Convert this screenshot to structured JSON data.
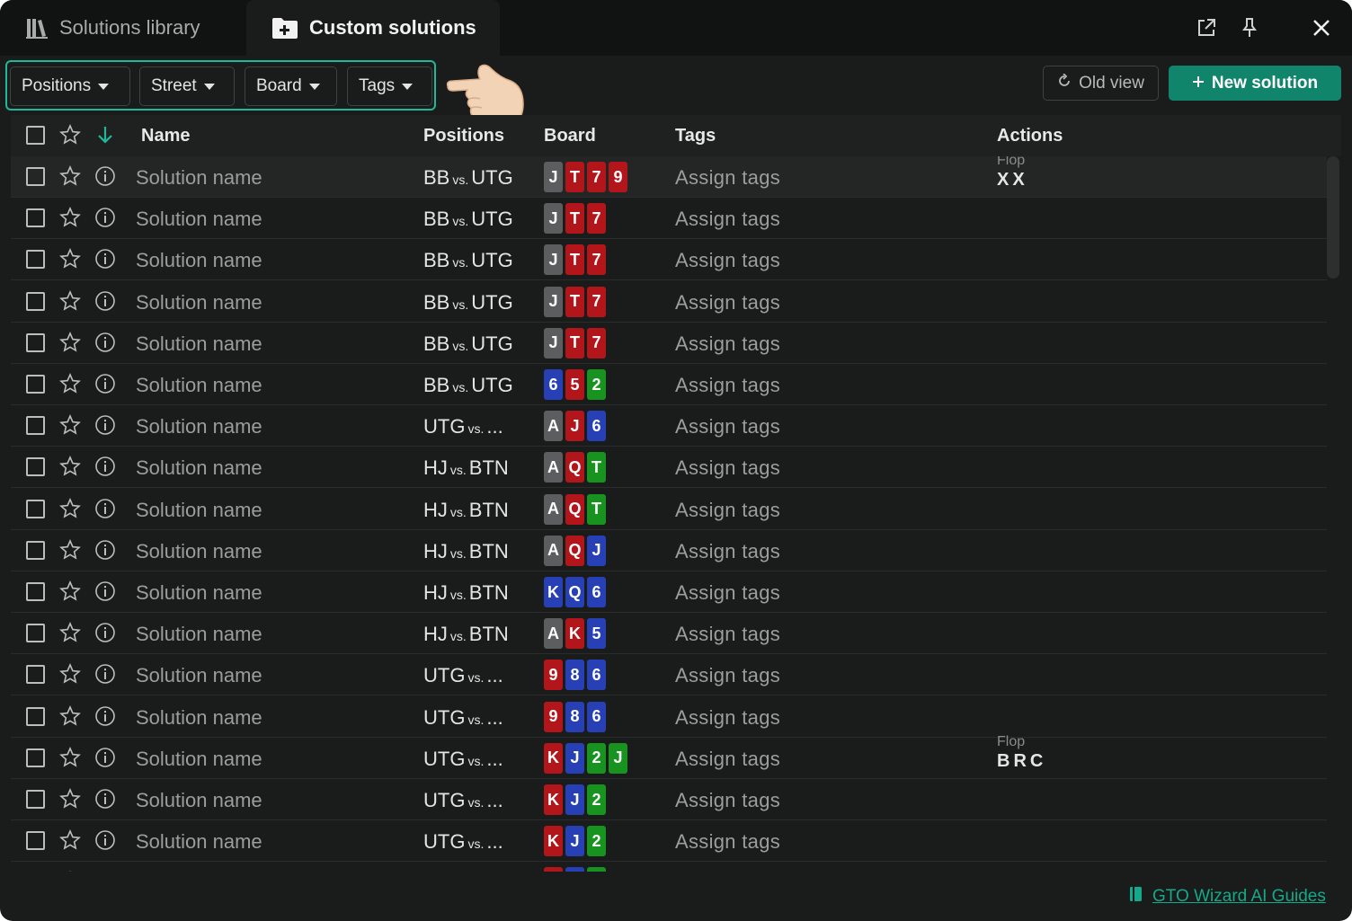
{
  "tabs": {
    "library_label": "Solutions library",
    "custom_label": "Custom solutions"
  },
  "filters": [
    {
      "label": "Positions"
    },
    {
      "label": "Street"
    },
    {
      "label": "Board"
    },
    {
      "label": "Tags"
    }
  ],
  "toolbar": {
    "old_view_label": "Old view",
    "new_solution_label": "New solution"
  },
  "columns": {
    "name": "Name",
    "positions": "Positions",
    "board": "Board",
    "tags": "Tags",
    "actions": "Actions"
  },
  "colors": {
    "accent": "#11856b",
    "filter_outline": "#1fb89a",
    "suit_spades": "#5b5d5e",
    "suit_hearts": "#b3161a",
    "suit_diamonds": "#2740b6",
    "suit_clubs": "#18931f"
  },
  "rows": [
    {
      "name": "Solution name",
      "pos_a": "BB",
      "vs": "vs.",
      "pos_b": "UTG",
      "cards": [
        {
          "r": "J",
          "s": "gray"
        },
        {
          "r": "T",
          "s": "red"
        },
        {
          "r": "7",
          "s": "red"
        },
        {
          "r": "9",
          "s": "red"
        }
      ],
      "tags": "Assign tags",
      "action_label": "Flop",
      "action_value": "XX",
      "selected": true
    },
    {
      "name": "Solution name",
      "pos_a": "BB",
      "vs": "vs.",
      "pos_b": "UTG",
      "cards": [
        {
          "r": "J",
          "s": "gray"
        },
        {
          "r": "T",
          "s": "red"
        },
        {
          "r": "7",
          "s": "red"
        }
      ],
      "tags": "Assign tags"
    },
    {
      "name": "Solution name",
      "pos_a": "BB",
      "vs": "vs.",
      "pos_b": "UTG",
      "cards": [
        {
          "r": "J",
          "s": "gray"
        },
        {
          "r": "T",
          "s": "red"
        },
        {
          "r": "7",
          "s": "red"
        }
      ],
      "tags": "Assign tags"
    },
    {
      "name": "Solution name",
      "pos_a": "BB",
      "vs": "vs.",
      "pos_b": "UTG",
      "cards": [
        {
          "r": "J",
          "s": "gray"
        },
        {
          "r": "T",
          "s": "red"
        },
        {
          "r": "7",
          "s": "red"
        }
      ],
      "tags": "Assign tags"
    },
    {
      "name": "Solution name",
      "pos_a": "BB",
      "vs": "vs.",
      "pos_b": "UTG",
      "cards": [
        {
          "r": "J",
          "s": "gray"
        },
        {
          "r": "T",
          "s": "red"
        },
        {
          "r": "7",
          "s": "red"
        }
      ],
      "tags": "Assign tags"
    },
    {
      "name": "Solution name",
      "pos_a": "BB",
      "vs": "vs.",
      "pos_b": "UTG",
      "cards": [
        {
          "r": "6",
          "s": "blue"
        },
        {
          "r": "5",
          "s": "red"
        },
        {
          "r": "2",
          "s": "green"
        }
      ],
      "tags": "Assign tags"
    },
    {
      "name": "Solution name",
      "pos_a": "UTG",
      "vs": "vs.",
      "pos_b": "...",
      "cards": [
        {
          "r": "A",
          "s": "gray"
        },
        {
          "r": "J",
          "s": "red"
        },
        {
          "r": "6",
          "s": "blue"
        }
      ],
      "tags": "Assign tags"
    },
    {
      "name": "Solution name",
      "pos_a": "HJ",
      "vs": "vs.",
      "pos_b": "BTN",
      "cards": [
        {
          "r": "A",
          "s": "gray"
        },
        {
          "r": "Q",
          "s": "red"
        },
        {
          "r": "T",
          "s": "green"
        }
      ],
      "tags": "Assign tags"
    },
    {
      "name": "Solution name",
      "pos_a": "HJ",
      "vs": "vs.",
      "pos_b": "BTN",
      "cards": [
        {
          "r": "A",
          "s": "gray"
        },
        {
          "r": "Q",
          "s": "red"
        },
        {
          "r": "T",
          "s": "green"
        }
      ],
      "tags": "Assign tags"
    },
    {
      "name": "Solution name",
      "pos_a": "HJ",
      "vs": "vs.",
      "pos_b": "BTN",
      "cards": [
        {
          "r": "A",
          "s": "gray"
        },
        {
          "r": "Q",
          "s": "red"
        },
        {
          "r": "J",
          "s": "blue"
        }
      ],
      "tags": "Assign tags"
    },
    {
      "name": "Solution name",
      "pos_a": "HJ",
      "vs": "vs.",
      "pos_b": "BTN",
      "cards": [
        {
          "r": "K",
          "s": "blue"
        },
        {
          "r": "Q",
          "s": "blue"
        },
        {
          "r": "6",
          "s": "blue"
        }
      ],
      "tags": "Assign tags"
    },
    {
      "name": "Solution name",
      "pos_a": "HJ",
      "vs": "vs.",
      "pos_b": "BTN",
      "cards": [
        {
          "r": "A",
          "s": "gray"
        },
        {
          "r": "K",
          "s": "red"
        },
        {
          "r": "5",
          "s": "blue"
        }
      ],
      "tags": "Assign tags"
    },
    {
      "name": "Solution name",
      "pos_a": "UTG",
      "vs": "vs.",
      "pos_b": "...",
      "cards": [
        {
          "r": "9",
          "s": "red"
        },
        {
          "r": "8",
          "s": "blue"
        },
        {
          "r": "6",
          "s": "blue"
        }
      ],
      "tags": "Assign tags"
    },
    {
      "name": "Solution name",
      "pos_a": "UTG",
      "vs": "vs.",
      "pos_b": "...",
      "cards": [
        {
          "r": "9",
          "s": "red"
        },
        {
          "r": "8",
          "s": "blue"
        },
        {
          "r": "6",
          "s": "blue"
        }
      ],
      "tags": "Assign tags"
    },
    {
      "name": "Solution name",
      "pos_a": "UTG",
      "vs": "vs.",
      "pos_b": "...",
      "cards": [
        {
          "r": "K",
          "s": "red"
        },
        {
          "r": "J",
          "s": "blue"
        },
        {
          "r": "2",
          "s": "green"
        },
        {
          "r": "J",
          "s": "green"
        }
      ],
      "tags": "Assign tags",
      "action_label": "Flop",
      "action_value": "BRC"
    },
    {
      "name": "Solution name",
      "pos_a": "UTG",
      "vs": "vs.",
      "pos_b": "...",
      "cards": [
        {
          "r": "K",
          "s": "red"
        },
        {
          "r": "J",
          "s": "blue"
        },
        {
          "r": "2",
          "s": "green"
        }
      ],
      "tags": "Assign tags"
    },
    {
      "name": "Solution name",
      "pos_a": "UTG",
      "vs": "vs.",
      "pos_b": "...",
      "cards": [
        {
          "r": "K",
          "s": "red"
        },
        {
          "r": "J",
          "s": "blue"
        },
        {
          "r": "2",
          "s": "green"
        }
      ],
      "tags": "Assign tags"
    },
    {
      "name": "",
      "pos_a": "",
      "vs": "",
      "pos_b": "",
      "cards": [
        {
          "r": "",
          "s": "red"
        },
        {
          "r": "",
          "s": "blue"
        },
        {
          "r": "",
          "s": "green"
        }
      ],
      "tags": ""
    }
  ],
  "footer": {
    "guides_label": "GTO Wizard AI Guides"
  }
}
